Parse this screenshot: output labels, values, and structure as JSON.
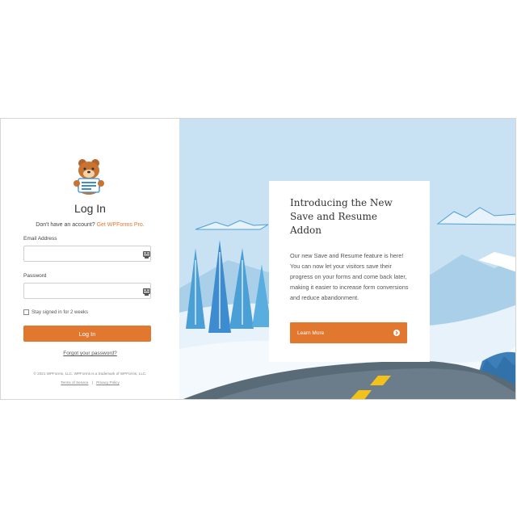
{
  "login": {
    "title": "Log In",
    "signup_text": "Don't have an account?",
    "signup_link": "Get WPForms Pro.",
    "email_label": "Email Address",
    "password_label": "Password",
    "remember_label": "Stay signed in for 2 weeks",
    "login_button": "Log In",
    "forgot_link": "Forgot your password?",
    "copyright": "© 2021 WPForms, LLC. WPForms is a trademark of WPForms, LLC.",
    "terms_link": "Terms of Service",
    "separator": "|",
    "privacy_link": "Privacy Policy"
  },
  "promo": {
    "title": "Introducing the New Save and Resume Addon",
    "body": "Our new Save and Resume feature is here! You can now let your visitors save their progress on your forms and come back later, making it easier to increase form conversions and reduce abandonment.",
    "button": "Learn More"
  },
  "colors": {
    "accent": "#e27730",
    "sky": "#c9e2f3",
    "snow": "#e8f2fa",
    "road": "#5a6b78",
    "tree": "#4a9fd6"
  },
  "icons": [
    "bear-mascot-icon",
    "password-manager-icon",
    "arrow-circle-right-icon"
  ]
}
